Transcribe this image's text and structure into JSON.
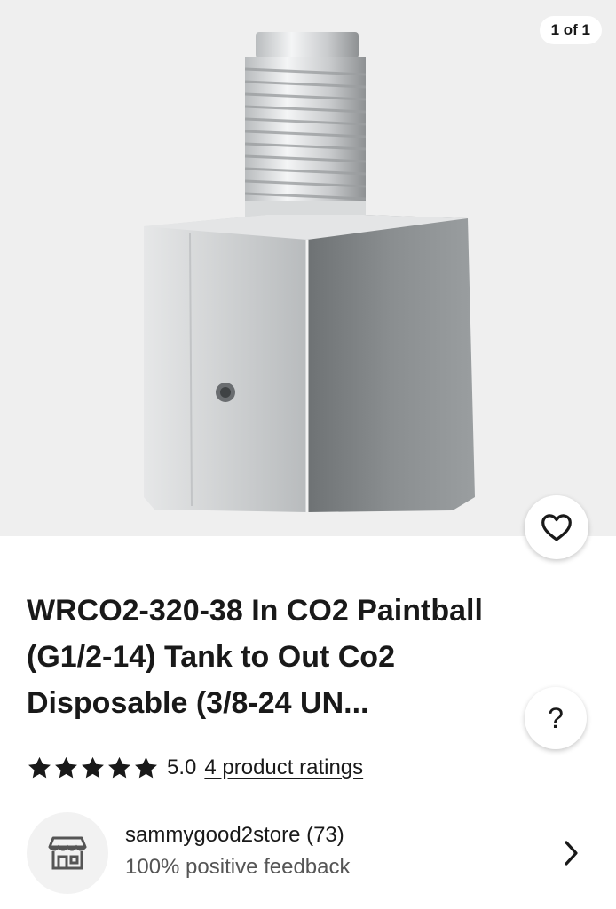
{
  "gallery": {
    "counter": "1 of 1",
    "image_alt": "CO2 paintball tank adapter, silver hex fitting"
  },
  "favorite": {
    "icon": "heart-outline-icon"
  },
  "listing": {
    "title": "WRCO2-320-38 In CO2 Paintball (G1/2-14) Tank to Out Co2 Disposable (3/8-24 UN..."
  },
  "help": {
    "label": "?"
  },
  "rating": {
    "stars_filled": 5,
    "stars_total": 5,
    "value": "5.0",
    "link_text": "4 product ratings"
  },
  "seller": {
    "name": "sammygood2store (73)",
    "feedback": "100% positive feedback",
    "icon": "store-icon"
  },
  "colors": {
    "text": "#191919",
    "secondary_text": "#555555",
    "image_background": "#efefef"
  }
}
